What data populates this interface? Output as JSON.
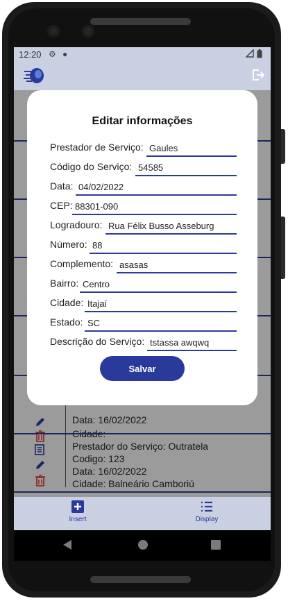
{
  "status_bar": {
    "time": "12:20"
  },
  "app": {
    "logo_icon": "brain-logo-icon",
    "logout_icon": "logout-icon"
  },
  "dialog": {
    "title": "Editar informações",
    "fields": [
      {
        "label": "Prestador de Serviço:",
        "value": "Gaules"
      },
      {
        "label": "Código do Serviço:",
        "value": "54585"
      },
      {
        "label": "Data:",
        "value": "04/02/2022"
      },
      {
        "label": "CEP:",
        "value": "88301-090"
      },
      {
        "label": "Logradouro:",
        "value": "Rua Félix Busso Asseburg"
      },
      {
        "label": "Número:",
        "value": "88"
      },
      {
        "label": "Complemento:",
        "value": "asasas"
      },
      {
        "label": "Bairro:",
        "value": "Centro"
      },
      {
        "label": "Cidade:",
        "value": "Itajaí"
      },
      {
        "label": "Estado:",
        "value": "SC"
      },
      {
        "label": "Descrição do Serviço:",
        "value": "tstassa awqwq"
      }
    ],
    "save_label": "Salvar"
  },
  "list": {
    "partial_card": {
      "line1": "Data: 16/02/2022",
      "line2": "Cidade:"
    },
    "card": {
      "line1": "Prestador do Serviço: Outratela",
      "line2": "Codigo: 123",
      "line3": "Data: 16/02/2022",
      "line4": "Cidade: Balneário Camboriú"
    }
  },
  "bottom_nav": {
    "insert_label": "Insert",
    "display_label": "Display"
  },
  "colors": {
    "accent": "#2a3a9a",
    "delete": "#d32f2f",
    "bar": "#c9d0e1"
  }
}
